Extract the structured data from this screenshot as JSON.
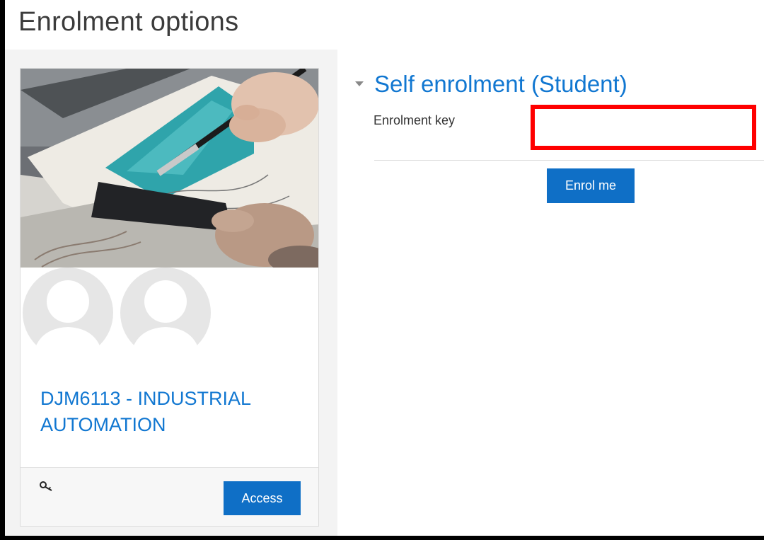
{
  "page": {
    "title": "Enrolment options"
  },
  "course_card": {
    "course_name": "DJM6113 - INDUSTRIAL AUTOMATION",
    "access_label": "Access",
    "footer_icon": "key-icon",
    "avatar_count": 2
  },
  "enrolment": {
    "section_title": "Self enrolment (Student)",
    "key_label": "Enrolment key",
    "key_value": "",
    "key_highlight_color": "#ff0000",
    "enrol_button_label": "Enrol me"
  },
  "colors": {
    "link": "#1177d1",
    "button": "#0f6fc6"
  }
}
